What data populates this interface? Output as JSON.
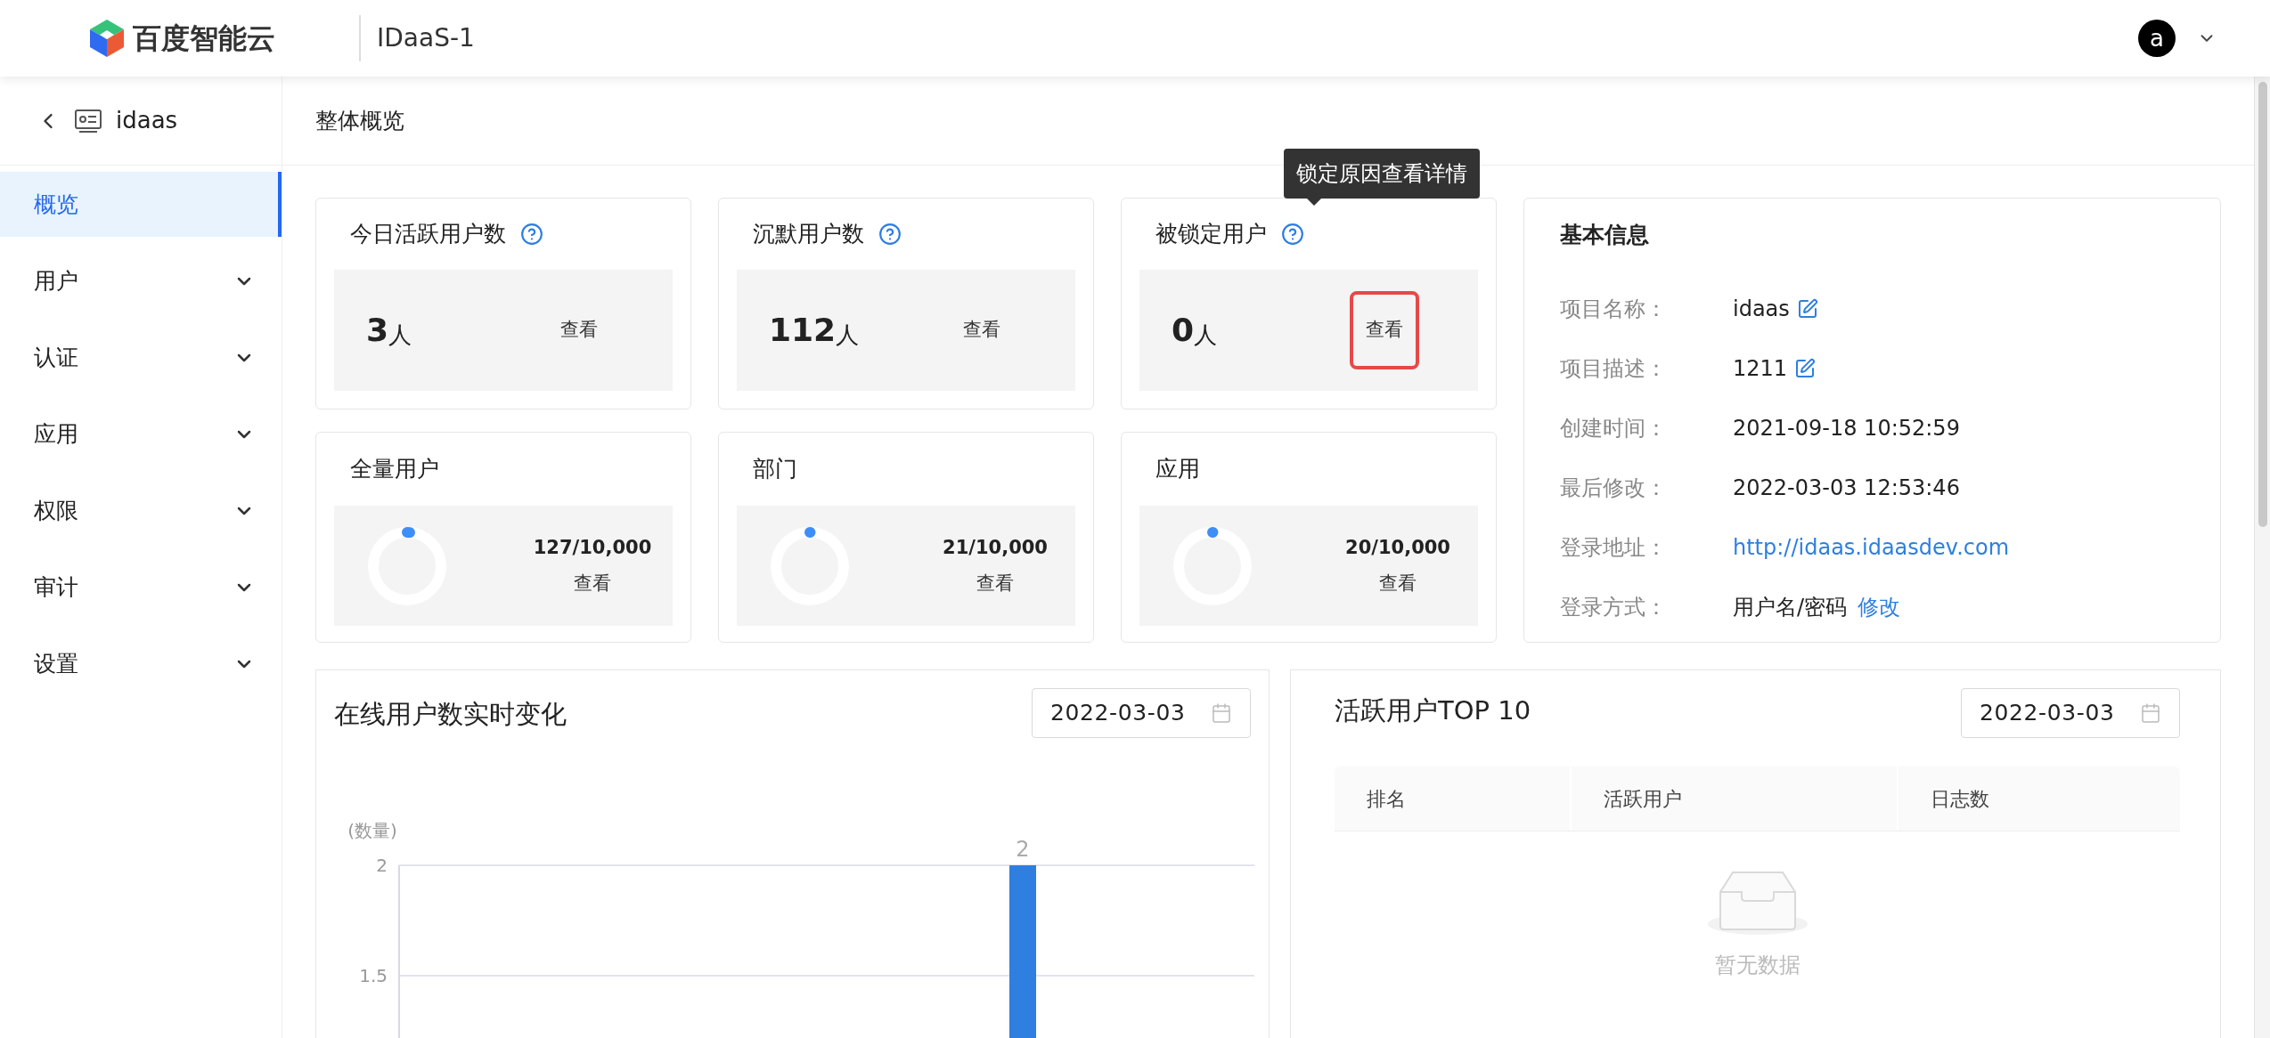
{
  "header": {
    "logo_text": "百度智能云",
    "project": "IDaaS-1",
    "avatar": "a"
  },
  "sidebar": {
    "back_label": "idaas",
    "items": [
      {
        "label": "概览",
        "selected": true,
        "expandable": false
      },
      {
        "label": "用户",
        "selected": false,
        "expandable": true
      },
      {
        "label": "认证",
        "selected": false,
        "expandable": true
      },
      {
        "label": "应用",
        "selected": false,
        "expandable": true
      },
      {
        "label": "权限",
        "selected": false,
        "expandable": true
      },
      {
        "label": "审计",
        "selected": false,
        "expandable": true
      },
      {
        "label": "设置",
        "selected": false,
        "expandable": true
      }
    ]
  },
  "breadcrumb": "整体概览",
  "stat_cards": [
    {
      "title": "今日活跃用户数",
      "help": true,
      "value": "3",
      "unit": "人",
      "action": "查看",
      "highlighted": false
    },
    {
      "title": "沉默用户数",
      "help": true,
      "value": "112",
      "unit": "人",
      "action": "查看",
      "highlighted": false
    },
    {
      "title": "被锁定用户",
      "help": true,
      "value": "0",
      "unit": "人",
      "action": "查看",
      "highlighted": true,
      "tooltip": "锁定原因查看详情"
    }
  ],
  "quota_cards": [
    {
      "title": "全量用户",
      "level": 0.0127,
      "reading": "127/10,000",
      "action": "查看"
    },
    {
      "title": "部门",
      "level": 0.0021,
      "reading": "21/10,000",
      "action": "查看"
    },
    {
      "title": "应用",
      "level": 0.002,
      "reading": "20/10,000",
      "action": "查看"
    }
  ],
  "basic_info": {
    "title": "基本信息",
    "rows": [
      {
        "label": "项目名称：",
        "value": "idaas",
        "kind": "editable"
      },
      {
        "label": "项目描述：",
        "value": "1211",
        "kind": "editable"
      },
      {
        "label": "创建时间：",
        "value": "2021-09-18 10:52:59",
        "kind": "text"
      },
      {
        "label": "最后修改：",
        "value": "2022-03-03 12:53:46",
        "kind": "text"
      },
      {
        "label": "登录地址：",
        "value": "http://idaas.idaasdev.com",
        "kind": "link"
      },
      {
        "label": "登录方式：",
        "value": "用户名/密码",
        "kind": "action",
        "action": "修改"
      }
    ]
  },
  "online_chart": {
    "title": "在线用户数实时变化",
    "date": "2022-03-03",
    "chart_data": {
      "type": "bar",
      "ylabel": "(数量)",
      "ylim": [
        0,
        2
      ],
      "yticks": [
        {
          "value": 2,
          "label": "2"
        },
        {
          "value": 1.5,
          "label": "1.5"
        }
      ],
      "values": [
        null,
        null,
        null,
        null,
        null,
        null,
        null,
        null,
        null,
        null,
        null,
        null,
        null,
        null,
        null,
        null,
        null,
        2,
        null,
        null,
        null,
        null,
        null,
        null
      ],
      "data_labels": true
    }
  },
  "top_users": {
    "title": "活跃用户TOP 10",
    "date": "2022-03-03",
    "columns": [
      "排名",
      "活跃用户",
      "日志数"
    ],
    "empty_text": "暂无数据"
  }
}
